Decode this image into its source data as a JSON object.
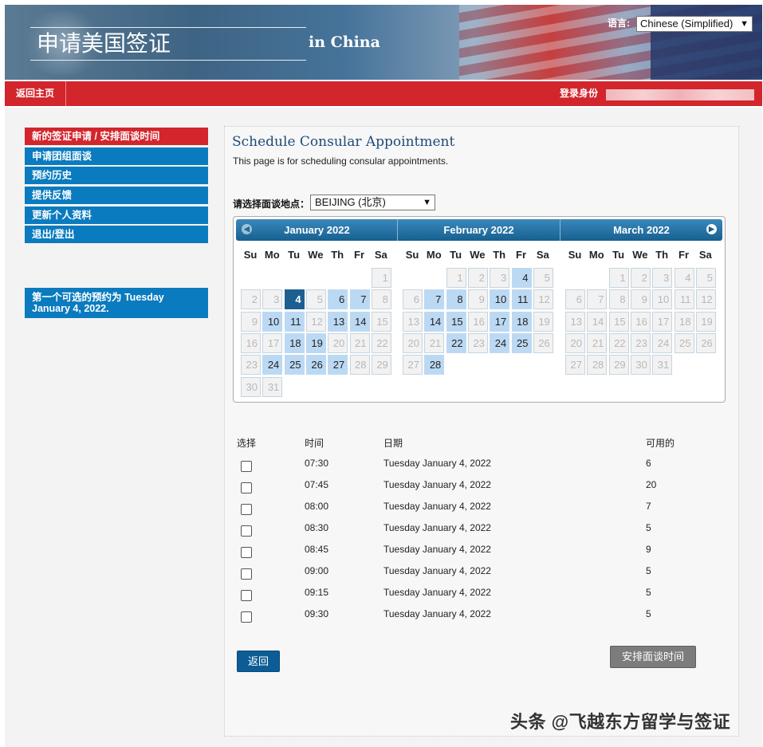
{
  "header": {
    "title": "申请美国签证",
    "subtitle": "in  China",
    "language_label": "语言:",
    "language_value": "Chinese (Simplified)"
  },
  "navbar": {
    "home": "返回主页",
    "login_label": "登录身份"
  },
  "sidebar": {
    "items": [
      {
        "label": "新的签证申请 / 安排面谈时间",
        "active": true
      },
      {
        "label": "申请团组面谈"
      },
      {
        "label": "预约历史"
      },
      {
        "label": "提供反馈"
      },
      {
        "label": "更新个人资料"
      },
      {
        "label": "退出/登出"
      }
    ],
    "note": "第一个可选的预约为 Tuesday January 4, 2022."
  },
  "main": {
    "title": "Schedule Consular Appointment",
    "description": "This page is for scheduling consular appointments.",
    "location_label": "请选择面谈地点：",
    "location_value": "BEIJING (北京)"
  },
  "calendar": {
    "weekdays": [
      "Su",
      "Mo",
      "Tu",
      "We",
      "Th",
      "Fr",
      "Sa"
    ],
    "months": [
      {
        "title": "January 2022",
        "first_dow": 6,
        "days": 31,
        "available": [
          4,
          6,
          7,
          10,
          11,
          13,
          14,
          18,
          19,
          24,
          25,
          26,
          27
        ],
        "selected": 4
      },
      {
        "title": "February 2022",
        "first_dow": 2,
        "days": 28,
        "available": [
          4,
          7,
          8,
          10,
          11,
          14,
          15,
          17,
          18,
          22,
          24,
          25,
          28
        ],
        "selected": null
      },
      {
        "title": "March 2022",
        "first_dow": 2,
        "days": 31,
        "available": [],
        "selected": null
      }
    ]
  },
  "slots": {
    "headers": {
      "select": "选择",
      "time": "时间",
      "date": "日期",
      "available": "可用的"
    },
    "rows": [
      {
        "time": "07:30",
        "date": "Tuesday January 4, 2022",
        "available": "6"
      },
      {
        "time": "07:45",
        "date": "Tuesday January 4, 2022",
        "available": "20"
      },
      {
        "time": "08:00",
        "date": "Tuesday January 4, 2022",
        "available": "7"
      },
      {
        "time": "08:30",
        "date": "Tuesday January 4, 2022",
        "available": "5"
      },
      {
        "time": "08:45",
        "date": "Tuesday January 4, 2022",
        "available": "9"
      },
      {
        "time": "09:00",
        "date": "Tuesday January 4, 2022",
        "available": "5"
      },
      {
        "time": "09:15",
        "date": "Tuesday January 4, 2022",
        "available": "5"
      },
      {
        "time": "09:30",
        "date": "Tuesday January 4, 2022",
        "available": "5"
      }
    ]
  },
  "buttons": {
    "back": "返回",
    "schedule": "安排面谈时间"
  },
  "watermark": "头条 @飞越东方留学与签证"
}
